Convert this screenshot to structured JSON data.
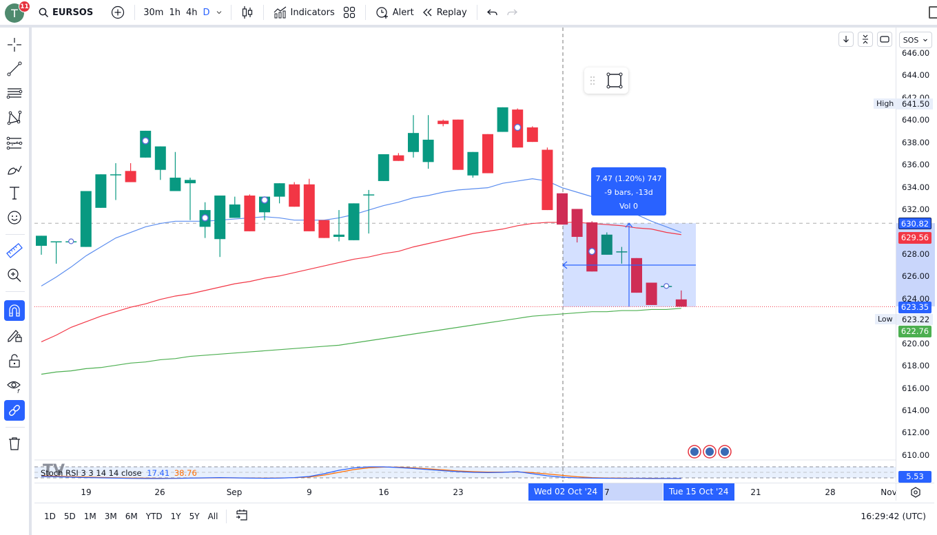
{
  "topbar": {
    "avatar_letter": "T",
    "notification_count": "11",
    "symbol": "EURSOS",
    "intervals": [
      "30m",
      "1h",
      "4h",
      "D"
    ],
    "active_interval": "D",
    "indicators_label": "Indicators",
    "alert_label": "Alert",
    "replay_label": "Replay"
  },
  "left_toolbar": {
    "tools": [
      {
        "name": "crosshair-icon"
      },
      {
        "name": "trend-line-icon"
      },
      {
        "name": "horizontal-lines-icon"
      },
      {
        "name": "pattern-icon"
      },
      {
        "name": "fib-retracement-icon"
      },
      {
        "name": "brush-icon"
      },
      {
        "name": "text-icon"
      },
      {
        "name": "emoji-icon"
      },
      {
        "name": "ruler-icon"
      },
      {
        "name": "zoom-in-icon"
      },
      {
        "name": "magnet-icon",
        "active": true
      },
      {
        "name": "lock-drawings-icon"
      },
      {
        "name": "unlock-icon"
      },
      {
        "name": "hide-icon"
      },
      {
        "name": "link-icon",
        "active": true
      },
      {
        "name": "trash-icon"
      }
    ]
  },
  "chart_controls": {
    "currency_select": "SOS"
  },
  "measure_tooltip": {
    "line1": "7.47 (1.20%) 747",
    "line2": "-9 bars, -13d",
    "line3": "Vol 0"
  },
  "price_scale": {
    "ticks": [
      "646.00",
      "644.00",
      "642.00",
      "640.00",
      "638.00",
      "636.00",
      "634.00",
      "632.00",
      "628.00",
      "626.00",
      "624.00",
      "620.00",
      "618.00",
      "616.00",
      "614.00",
      "612.00",
      "610.00"
    ],
    "high_label": "High",
    "high_value": "641.50",
    "low_label": "Low",
    "low_value": "623.22",
    "tag_measure_top": "630.82",
    "tag_ma_red": "629.56",
    "tag_last": "623.35",
    "tag_ma_green": "622.76",
    "stoch_value": "5.53",
    "colors": {
      "blue": "#2962ff",
      "red": "#f23645",
      "green": "#4caf50"
    }
  },
  "stoch_rsi": {
    "label": "Stoch RSI 3 3 14 14 close",
    "k_value": "17.41",
    "d_value": "38.76",
    "k_color": "#2962ff",
    "d_color": "#ff6d00"
  },
  "time_axis": {
    "labels": [
      "19",
      "26",
      "Sep",
      "9",
      "16",
      "23",
      "7",
      "21",
      "28",
      "Nov"
    ],
    "highlight_start": "Wed 02 Oct '24",
    "highlight_end": "Tue 15 Oct '24"
  },
  "bottom_bar": {
    "ranges": [
      "1D",
      "5D",
      "1M",
      "3M",
      "6M",
      "YTD",
      "1Y",
      "5Y",
      "All"
    ],
    "clock": "16:29:42 (UTC)"
  },
  "chart_data": {
    "type": "candlestick",
    "symbol": "EURSOS",
    "interval": "D",
    "ylim": [
      609.5,
      646.5
    ],
    "candles": [
      {
        "o": 628.8,
        "h": 629.7,
        "l": 628.0,
        "c": 629.7
      },
      {
        "o": 629.2,
        "h": 629.2,
        "l": 627.2,
        "c": 629.2
      },
      {
        "o": 629.2,
        "h": 629.2,
        "l": 629.2,
        "c": 629.2
      },
      {
        "o": 628.7,
        "h": 633.7,
        "l": 628.7,
        "c": 633.7
      },
      {
        "o": 632.2,
        "h": 635.2,
        "l": 632.2,
        "c": 635.2
      },
      {
        "o": 635.2,
        "h": 636.2,
        "l": 632.9,
        "c": 635.2
      },
      {
        "o": 635.5,
        "h": 636.2,
        "l": 634.5,
        "c": 634.5
      },
      {
        "o": 636.7,
        "h": 639.1,
        "l": 636.7,
        "c": 639.1
      },
      {
        "o": 635.6,
        "h": 637.7,
        "l": 634.7,
        "c": 637.7
      },
      {
        "o": 633.7,
        "h": 637.2,
        "l": 633.7,
        "c": 634.9
      },
      {
        "o": 634.4,
        "h": 634.9,
        "l": 631.1,
        "c": 634.7
      },
      {
        "o": 630.5,
        "h": 632.7,
        "l": 629.5,
        "c": 632.0
      },
      {
        "o": 629.4,
        "h": 633.3,
        "l": 627.8,
        "c": 633.3
      },
      {
        "o": 631.3,
        "h": 633.2,
        "l": 631.3,
        "c": 632.5
      },
      {
        "o": 633.3,
        "h": 633.4,
        "l": 630.1,
        "c": 630.1
      },
      {
        "o": 631.8,
        "h": 633.2,
        "l": 631.1,
        "c": 633.2
      },
      {
        "o": 633.2,
        "h": 634.4,
        "l": 632.6,
        "c": 634.4
      },
      {
        "o": 634.3,
        "h": 634.5,
        "l": 632.3,
        "c": 632.3
      },
      {
        "o": 634.3,
        "h": 634.8,
        "l": 630.1,
        "c": 630.1
      },
      {
        "o": 631.1,
        "h": 631.1,
        "l": 629.5,
        "c": 629.5
      },
      {
        "o": 629.6,
        "h": 632.0,
        "l": 629.2,
        "c": 629.8
      },
      {
        "o": 629.3,
        "h": 632.6,
        "l": 629.3,
        "c": 632.6
      },
      {
        "o": 633.4,
        "h": 633.8,
        "l": 629.9,
        "c": 633.4
      },
      {
        "o": 634.6,
        "h": 637.0,
        "l": 634.6,
        "c": 637.0
      },
      {
        "o": 636.9,
        "h": 637.1,
        "l": 636.4,
        "c": 636.4
      },
      {
        "o": 637.2,
        "h": 640.5,
        "l": 636.7,
        "c": 638.9
      },
      {
        "o": 636.3,
        "h": 640.5,
        "l": 635.7,
        "c": 638.3
      },
      {
        "o": 640.0,
        "h": 640.1,
        "l": 639.5,
        "c": 639.7
      },
      {
        "o": 640.1,
        "h": 640.1,
        "l": 635.6,
        "c": 635.6
      },
      {
        "o": 635.1,
        "h": 637.2,
        "l": 634.9,
        "c": 637.2
      },
      {
        "o": 638.8,
        "h": 638.8,
        "l": 635.3,
        "c": 635.3
      },
      {
        "o": 639.0,
        "h": 641.2,
        "l": 639.0,
        "c": 641.2
      },
      {
        "o": 641.0,
        "h": 641.1,
        "l": 637.6,
        "c": 637.6
      },
      {
        "o": 639.4,
        "h": 639.5,
        "l": 638.1,
        "c": 638.1
      },
      {
        "o": 637.4,
        "h": 637.6,
        "l": 632.0,
        "c": 632.0
      },
      {
        "o": 633.5,
        "h": 633.5,
        "l": 630.7,
        "c": 630.7
      },
      {
        "o": 632.1,
        "h": 632.1,
        "l": 629.1,
        "c": 629.6
      },
      {
        "o": 630.9,
        "h": 631.0,
        "l": 626.5,
        "c": 626.5
      },
      {
        "o": 628.0,
        "h": 630.0,
        "l": 628.0,
        "c": 629.8
      },
      {
        "o": 628.3,
        "h": 628.7,
        "l": 627.2,
        "c": 628.3
      },
      {
        "o": 627.7,
        "h": 627.7,
        "l": 624.6,
        "c": 624.6
      },
      {
        "o": 625.5,
        "h": 625.5,
        "l": 623.5,
        "c": 623.5
      },
      {
        "o": 625.2,
        "h": 625.2,
        "l": 625.2,
        "c": 625.2
      },
      {
        "o": 624.0,
        "h": 624.8,
        "l": 623.35,
        "c": 623.35
      }
    ],
    "candle_slots": [
      0,
      1,
      2,
      3,
      4,
      5,
      6,
      7,
      8,
      9,
      10,
      11,
      12,
      13,
      14,
      15,
      16,
      17,
      18,
      19,
      20,
      21,
      22,
      23,
      24,
      25,
      26,
      27,
      28,
      29,
      30,
      31,
      32,
      33,
      34,
      35,
      36,
      37,
      38,
      39,
      40,
      41,
      42,
      43
    ],
    "ma_blue": [
      625.2,
      626.0,
      626.9,
      627.9,
      628.7,
      629.5,
      630.0,
      630.5,
      630.8,
      631.0,
      631.0,
      631.0,
      631.1,
      631.2,
      631.3,
      631.4,
      631.3,
      631.1,
      631.1,
      631.1,
      631.3,
      631.6,
      632.0,
      632.4,
      632.7,
      633.1,
      633.3,
      633.6,
      633.8,
      633.9,
      634.0,
      634.4,
      634.6,
      634.8,
      634.6,
      634.0,
      633.6,
      633.2,
      632.7,
      632.1,
      631.6,
      631.0,
      630.5,
      630.0
    ],
    "ma_red": [
      620.2,
      620.8,
      621.5,
      622.0,
      622.5,
      622.9,
      623.3,
      623.6,
      624.0,
      624.3,
      624.5,
      624.8,
      625.1,
      625.4,
      625.6,
      625.9,
      626.1,
      626.4,
      626.7,
      627.0,
      627.3,
      627.6,
      627.8,
      628.1,
      628.3,
      628.7,
      629.0,
      629.3,
      629.6,
      629.9,
      630.1,
      630.3,
      630.6,
      630.8,
      630.9,
      630.9,
      630.9,
      630.8,
      630.7,
      630.6,
      630.4,
      630.3,
      630.0,
      629.8
    ],
    "ma_green": [
      617.3,
      617.5,
      617.6,
      617.8,
      617.9,
      618.1,
      618.3,
      618.4,
      618.6,
      618.7,
      618.9,
      619.0,
      619.1,
      619.2,
      619.3,
      619.4,
      619.5,
      619.6,
      619.7,
      619.8,
      619.9,
      620.1,
      620.3,
      620.5,
      620.7,
      620.9,
      621.1,
      621.3,
      621.5,
      621.7,
      621.9,
      622.1,
      622.3,
      622.5,
      622.6,
      622.7,
      622.8,
      622.9,
      622.9,
      623.0,
      623.0,
      623.1,
      623.1,
      623.2
    ],
    "stoch_k": [
      20,
      18,
      15,
      12,
      10,
      8,
      6,
      5,
      5,
      6,
      8,
      10,
      12,
      10,
      8,
      7,
      8,
      12,
      20,
      40,
      65,
      82,
      90,
      90,
      85,
      78,
      70,
      62,
      55,
      50,
      48,
      50,
      55,
      40,
      25,
      15,
      10,
      8,
      7,
      6,
      6,
      5,
      5,
      5
    ],
    "stoch_d": [
      25,
      22,
      19,
      16,
      13,
      11,
      9,
      8,
      7,
      7,
      8,
      9,
      10,
      10,
      9,
      8,
      9,
      11,
      16,
      30,
      50,
      70,
      83,
      88,
      88,
      82,
      76,
      68,
      60,
      55,
      52,
      52,
      53,
      48,
      38,
      28,
      18,
      12,
      9,
      8,
      7,
      7,
      6,
      6
    ],
    "measure_box": {
      "from_price": 630.82,
      "to_price": 623.35,
      "change": 7.47,
      "change_pct": 1.2,
      "bars": -9,
      "days": -13
    }
  }
}
